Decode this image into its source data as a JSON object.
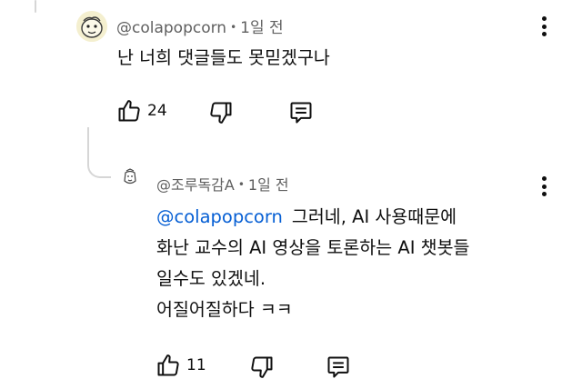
{
  "comment": {
    "author": "@colapopcorn",
    "separator": "•",
    "time": "1일 전",
    "text": "난 너희 댓글들도 못믿겠구나",
    "like_count": "24"
  },
  "reply": {
    "author": "@조루독감A",
    "separator": "•",
    "time": "1일 전",
    "mention": "@colapopcorn",
    "lines": [
      "그러네, AI 사용때문에",
      "화난 교수의 AI 영상을 토론하는 AI 챗봇들",
      "일수도 있겠네.",
      "어질어질하다 ㅋㅋ"
    ],
    "like_count": "11"
  },
  "icons": {
    "like": "thumbs-up-icon",
    "dislike": "thumbs-down-icon",
    "reply": "comment-icon",
    "more": "more-vert-icon"
  }
}
